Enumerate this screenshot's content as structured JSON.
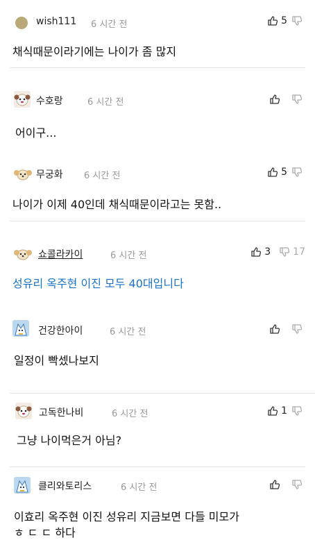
{
  "colors": {
    "link_blue": "#1a73c9",
    "time_gray": "#999999",
    "divider": "#e3e3e3"
  },
  "comments": [
    {
      "nick": "wish111",
      "time": "6 시간 전",
      "up": "5",
      "down": "",
      "text": "채식때문이라기에는 나이가 좀 많지",
      "avatar_icon": "khaki-dot-avatar"
    },
    {
      "nick": "수호랑",
      "time": "6 시간 전",
      "up": "",
      "down": "",
      "text": "어이구...",
      "avatar_icon": "puppy-avatar"
    },
    {
      "nick": "무궁화",
      "time": "6 시간 전",
      "up": "5",
      "down": "",
      "text": "나이가 이제 40인데 채식때문이라고는 못함..",
      "avatar_icon": "puppy-avatar"
    },
    {
      "nick": "쇼콜라카이",
      "time": "6 시간 전",
      "up": "3",
      "down": "17",
      "text": "성유리 옥주현 이진 모두 40대입니다",
      "avatar_icon": "puppy-avatar"
    },
    {
      "nick": "건강한아이",
      "time": "6 시간 전",
      "up": "",
      "down": "",
      "text": "일정이 빡셌나보지",
      "avatar_icon": "blue-cat-avatar"
    },
    {
      "nick": "고독한나비",
      "time": "6 시간 전",
      "up": "1",
      "down": "",
      "text": "그냥 나이먹은거 아님?",
      "avatar_icon": "puppy-avatar"
    },
    {
      "nick": "클리와토리스",
      "time": "6 시간 전",
      "up": "",
      "down": "",
      "text": "이효리 옥주현 이진 성유리 지금보면 다들 미모가",
      "text2": "ㅎ ㄷ ㄷ 하다",
      "avatar_icon": "blue-cat-avatar"
    }
  ]
}
